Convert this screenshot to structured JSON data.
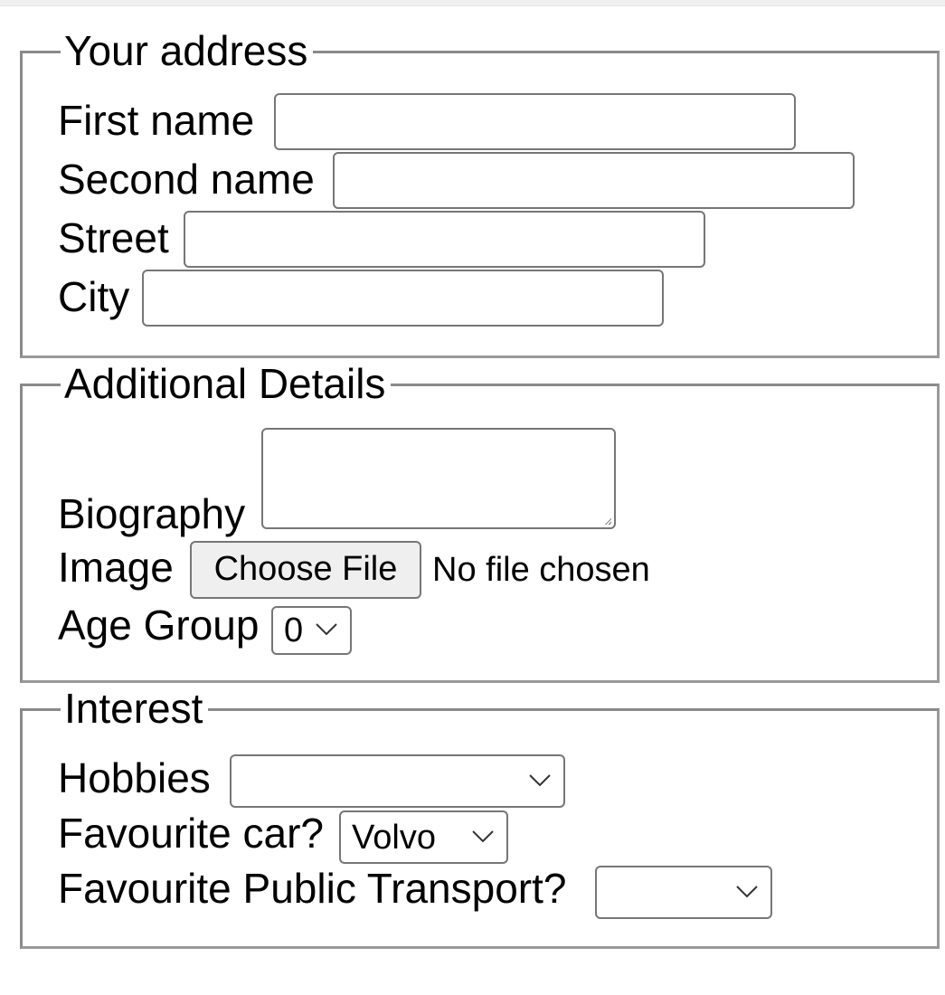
{
  "address": {
    "legend": "Your address",
    "first_name_label": "First name",
    "first_name_value": "",
    "second_name_label": "Second name",
    "second_name_value": "",
    "street_label": "Street",
    "street_value": "",
    "city_label": "City",
    "city_value": ""
  },
  "details": {
    "legend": "Additional Details",
    "biography_label": "Biography",
    "biography_value": "",
    "image_label": "Image",
    "choose_file_label": "Choose File",
    "file_status": "No file chosen",
    "age_group_label": "Age Group",
    "age_group_value": "0"
  },
  "interest": {
    "legend": "Interest",
    "hobbies_label": "Hobbies",
    "hobbies_value": "",
    "car_label": "Favourite car?",
    "car_value": "Volvo",
    "transport_label": "Favourite Public Transport?",
    "transport_value": ""
  },
  "icons": {
    "dropdown": "chevron-down-icon",
    "resize": "resize-grip-icon"
  },
  "colors": {
    "border": "#767676",
    "fieldset_border": "#8a8a8a",
    "button_bg": "#efefef"
  }
}
